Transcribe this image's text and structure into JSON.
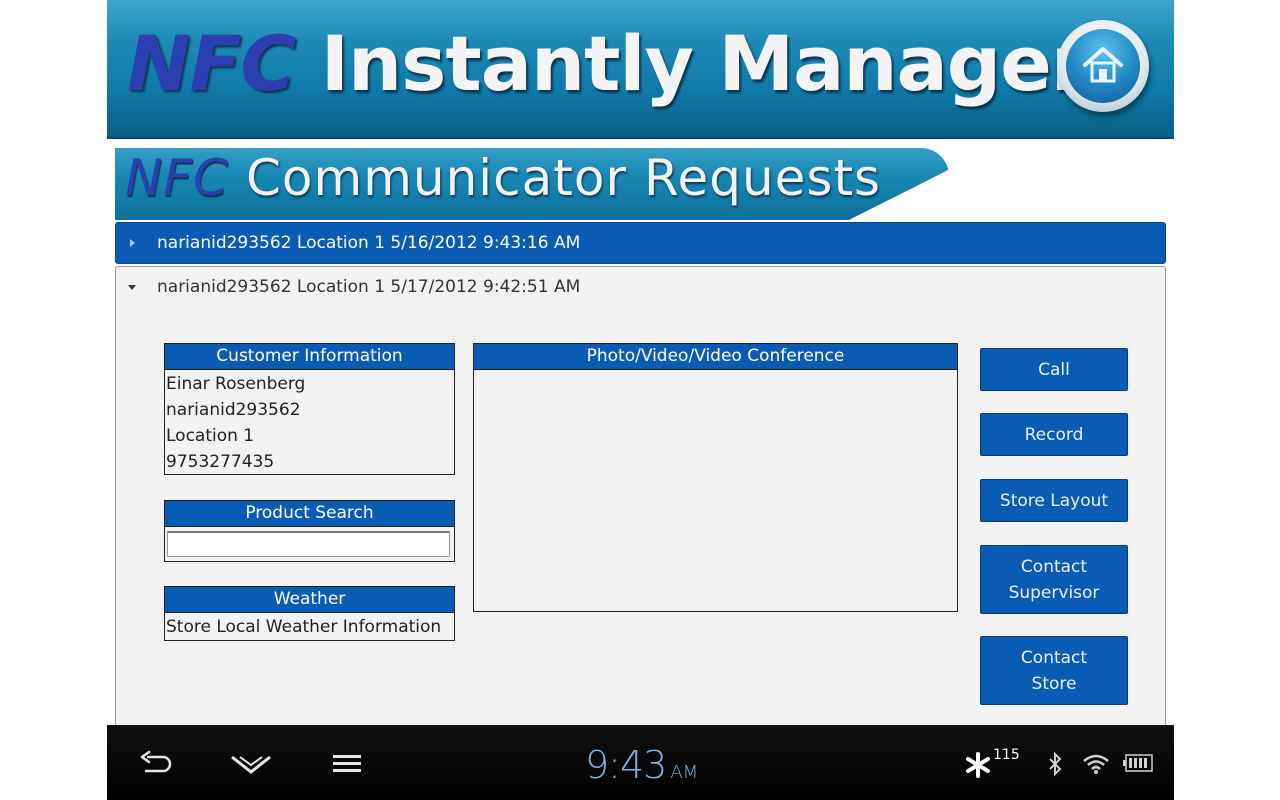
{
  "banner": {
    "title_nfc": "NFC",
    "title_rest": "Instantly Manager"
  },
  "section": {
    "title_nfc": "NFC",
    "title_rest": "Communicator Requests"
  },
  "requests": [
    {
      "label": "narianid293562 Location 1 5/16/2012 9:43:16 AM",
      "expanded": false
    },
    {
      "label": "narianid293562 Location 1 5/17/2012 9:42:51 AM",
      "expanded": true
    }
  ],
  "customer": {
    "header": "Customer Information",
    "name": "Einar Rosenberg",
    "id": "narianid293562",
    "location": "Location 1",
    "phone": "9753277435"
  },
  "product_search": {
    "header": "Product Search",
    "value": ""
  },
  "weather": {
    "header": "Weather",
    "text": "Store Local Weather Information"
  },
  "media": {
    "header": "Photo/Video/Video Conference"
  },
  "actions": {
    "call": "Call",
    "record": "Record",
    "store_layout": "Store Layout",
    "contact_supervisor": "Contact Supervisor",
    "contact_store": "Contact Store"
  },
  "system_bar": {
    "time": "9:43",
    "ampm": "AM",
    "notification_count": "115"
  },
  "colors": {
    "accent_blue": "#0a5bb4",
    "banner_teal": "#1887b4",
    "panel_bg": "#f2f2f2"
  }
}
